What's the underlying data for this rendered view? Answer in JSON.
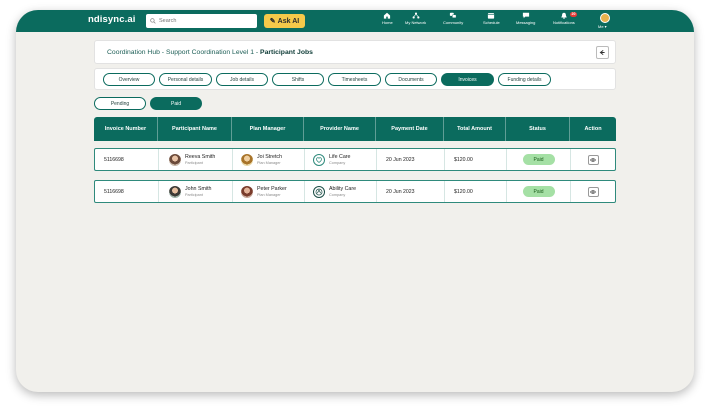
{
  "topbar": {
    "brand": "ndisync.ai",
    "search_placeholder": "Search",
    "ask_ai_label": "Ask AI",
    "nav": [
      {
        "label": "Home",
        "icon": "home-icon"
      },
      {
        "label": "My Network",
        "icon": "network-icon"
      },
      {
        "label": "Community",
        "icon": "community-icon"
      },
      {
        "label": "Schedule",
        "icon": "schedule-icon"
      },
      {
        "label": "Messaging",
        "icon": "messaging-icon"
      },
      {
        "label": "Notifications",
        "icon": "bell-icon",
        "badge": "20"
      }
    ],
    "me_label": "Me ▾"
  },
  "header": {
    "breadcrumb": "Coordination Hub - Support Coordination Level 1 - ",
    "current": "Participant Jobs"
  },
  "tabs": [
    {
      "label": "Overview",
      "active": false
    },
    {
      "label": "Personal details",
      "active": false
    },
    {
      "label": "Job details",
      "active": false
    },
    {
      "label": "Shifts",
      "active": false
    },
    {
      "label": "Timesheets",
      "active": false
    },
    {
      "label": "Documents",
      "active": false
    },
    {
      "label": "Invoices",
      "active": true
    },
    {
      "label": "Funding details",
      "active": false
    }
  ],
  "filters": {
    "pending_label": "Pending",
    "paid_label": "Paid",
    "selected": "Paid"
  },
  "table": {
    "columns": [
      "Invoice Number",
      "Participant Name",
      "Plan Manager",
      "Provider Name",
      "Payment Date",
      "Total Amount",
      "Status",
      "Action"
    ],
    "rows": [
      {
        "invoice_number": "5116698",
        "participant_name": "Reeva Smith",
        "participant_role": "Participant",
        "plan_manager": "Joi Stretch",
        "plan_manager_role": "Plan Manager",
        "provider_name": "Life Care",
        "provider_type": "Company",
        "payment_date": "20 Jun 2023",
        "total_amount": "$120.00",
        "status": "Paid"
      },
      {
        "invoice_number": "5116698",
        "participant_name": "John Smith",
        "participant_role": "Participant",
        "plan_manager": "Peter Parker",
        "plan_manager_role": "Plan Manager",
        "provider_name": "Ability Care",
        "provider_type": "Company",
        "payment_date": "20 Jun 2023",
        "total_amount": "$120.00",
        "status": "Paid"
      }
    ]
  },
  "colors": {
    "brand_teal": "#0b6b5e",
    "status_paid_bg": "#a5e0a5",
    "ask_ai_yellow": "#f5c94a"
  }
}
